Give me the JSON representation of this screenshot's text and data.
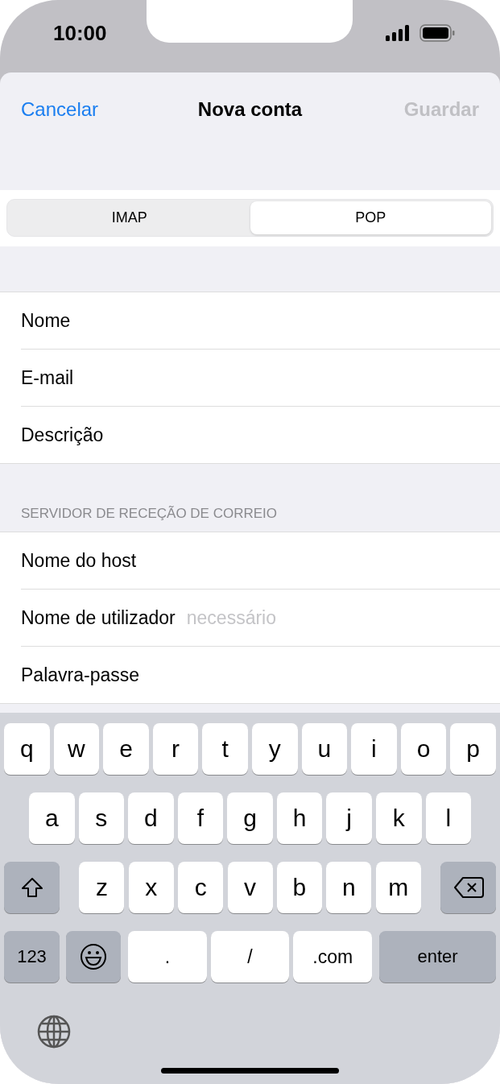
{
  "status_bar": {
    "time": "10:00"
  },
  "nav": {
    "cancel": "Cancelar",
    "title": "Nova conta",
    "save": {
      "label": "Guardar",
      "disabled": true
    }
  },
  "segments": [
    {
      "label": "IMAP",
      "selected": false
    },
    {
      "label": "POP",
      "selected": true
    }
  ],
  "sections": [
    {
      "rows": [
        {
          "label": "Nome"
        },
        {
          "label": "E-mail"
        },
        {
          "label": "Descrição"
        }
      ]
    },
    {
      "header": "SERVIDOR DE RECEÇÃO DE CORREIO",
      "rows": [
        {
          "label": "Nome do host"
        },
        {
          "label": "Nome de utilizador",
          "placeholder": "necessário"
        },
        {
          "label": "Palavra-passe"
        }
      ]
    }
  ],
  "keyboard": {
    "rows": [
      {
        "keys": [
          {
            "kind": "letter",
            "label": "q"
          },
          {
            "kind": "letter",
            "label": "w"
          },
          {
            "kind": "letter",
            "label": "e"
          },
          {
            "kind": "letter",
            "label": "r"
          },
          {
            "kind": "letter",
            "label": "t"
          },
          {
            "kind": "letter",
            "label": "y"
          },
          {
            "kind": "letter",
            "label": "u"
          },
          {
            "kind": "letter",
            "label": "i"
          },
          {
            "kind": "letter",
            "label": "o"
          },
          {
            "kind": "letter",
            "label": "p"
          }
        ]
      },
      {
        "keys": [
          {
            "kind": "letter",
            "label": "a"
          },
          {
            "kind": "letter",
            "label": "s"
          },
          {
            "kind": "letter",
            "label": "d"
          },
          {
            "kind": "letter",
            "label": "f"
          },
          {
            "kind": "letter",
            "label": "g"
          },
          {
            "kind": "letter",
            "label": "h"
          },
          {
            "kind": "letter",
            "label": "j"
          },
          {
            "kind": "letter",
            "label": "k"
          },
          {
            "kind": "letter",
            "label": "l"
          }
        ]
      },
      {
        "keys": [
          {
            "kind": "shift"
          },
          {
            "kind": "letter",
            "label": "z"
          },
          {
            "kind": "letter",
            "label": "x"
          },
          {
            "kind": "letter",
            "label": "c"
          },
          {
            "kind": "letter",
            "label": "v"
          },
          {
            "kind": "letter",
            "label": "b"
          },
          {
            "kind": "letter",
            "label": "n"
          },
          {
            "kind": "letter",
            "label": "m"
          },
          {
            "kind": "backspace"
          }
        ]
      },
      {
        "keys": [
          {
            "kind": "mode",
            "label": "123"
          },
          {
            "kind": "emoji"
          },
          {
            "kind": "symbol",
            "label": "."
          },
          {
            "kind": "symbol",
            "label": "/"
          },
          {
            "kind": "symbol",
            "label": ".com"
          },
          {
            "kind": "enter",
            "label": "enter"
          }
        ]
      }
    ]
  }
}
